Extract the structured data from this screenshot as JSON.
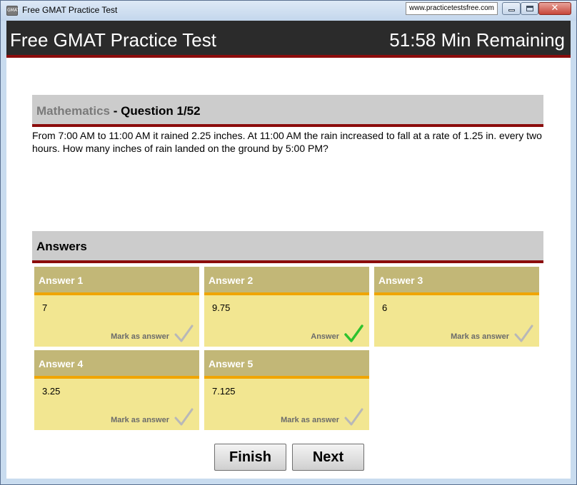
{
  "window": {
    "title": "Free GMAT Practice Test",
    "url_badge": "www.practicetestsfree.com",
    "icon_text": "GMAT"
  },
  "header": {
    "title": "Free GMAT Practice Test",
    "timer": "51:58 Min Remaining"
  },
  "question": {
    "subject": "Mathematics",
    "number": " - Question 1/52",
    "text": "From 7:00 AM to 11:00 AM it rained 2.25 inches. At 11:00 AM the rain increased to fall at a rate of 1.25 in. every two hours. How many inches of rain landed on the ground by 5:00 PM?"
  },
  "answers": {
    "title": "Answers",
    "items": [
      {
        "label": "Answer 1",
        "value": "7",
        "mark": "Mark as answer",
        "selected": false
      },
      {
        "label": "Answer 2",
        "value": "9.75",
        "mark": "Answer",
        "selected": true
      },
      {
        "label": "Answer 3",
        "value": "6",
        "mark": "Mark as answer",
        "selected": false
      },
      {
        "label": "Answer 4",
        "value": "3.25",
        "mark": "Mark as answer",
        "selected": false
      },
      {
        "label": "Answer 5",
        "value": "7.125",
        "mark": "Mark as answer",
        "selected": false
      }
    ]
  },
  "buttons": {
    "finish": "Finish",
    "next": "Next"
  },
  "colors": {
    "header_bg": "#2b2b2b",
    "accent_red": "#8b0c0c",
    "card_bg": "#f2e691",
    "card_head": "#c2b777",
    "card_stripe": "#f0a500",
    "check_selected": "#2ec22e",
    "check_unselected": "#b8b8b8"
  }
}
